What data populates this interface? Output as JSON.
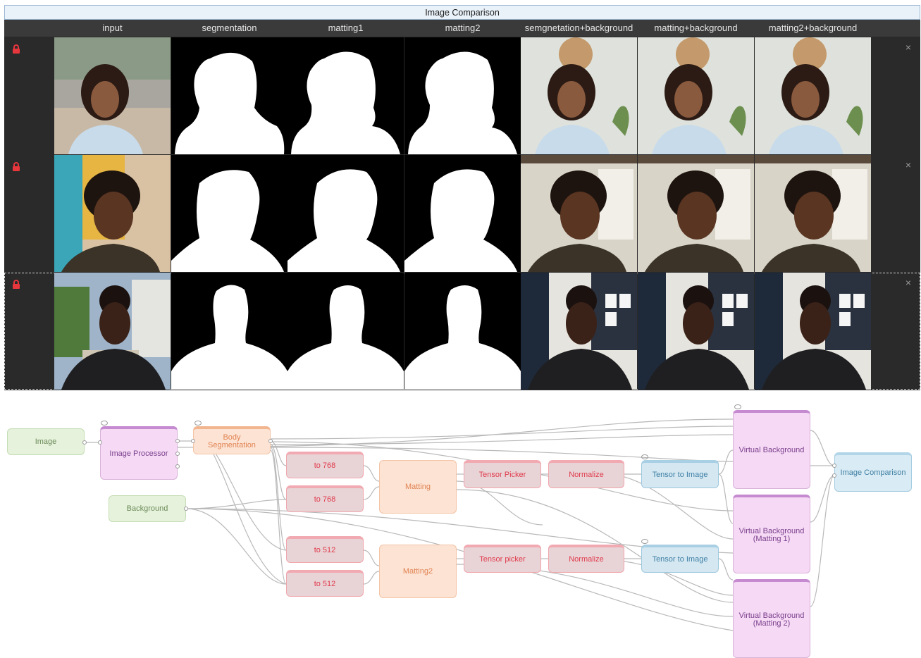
{
  "panel": {
    "title": "Image Comparison",
    "columns": [
      "input",
      "segmentation",
      "matting1",
      "matting2",
      "semgnetation+background",
      "matting+background",
      "matting2+background"
    ]
  },
  "rows": [
    {
      "locked": true,
      "close_label": "×",
      "selected": false
    },
    {
      "locked": true,
      "close_label": "×",
      "selected": false
    },
    {
      "locked": true,
      "close_label": "×",
      "selected": true
    }
  ],
  "graph": {
    "nodes": {
      "image": "Image",
      "image_processor": "Image Processor",
      "body_segmentation": "Body\nSegmentation",
      "background": "Background",
      "to768_a": "to 768",
      "to768_b": "to 768",
      "to512_a": "to 512",
      "to512_b": "to 512",
      "matting": "Matting",
      "matting2": "Matting2",
      "tensor_picker_a": "Tensor Picker",
      "tensor_picker_b": "Tensor picker",
      "normalize_a": "Normalize",
      "normalize_b": "Normalize",
      "tensor_to_image_a": "Tensor to Image",
      "tensor_to_image_b": "Tensor to Image",
      "vb": "Virtual Background",
      "vb_m1": "Virtual Background\n(Matting 1)",
      "vb_m2": "Virtual Background\n(Matting 2)",
      "image_comparison": "Image Comparison"
    }
  },
  "colors": {
    "accent": "#2b8cd8",
    "lock": "#e8363d",
    "panel_bg": "#2a2a2a",
    "header_bg": "#3a3a3a"
  },
  "icons": {
    "lock": "lock-icon",
    "close": "close-icon",
    "visibility": "eye-icon"
  }
}
